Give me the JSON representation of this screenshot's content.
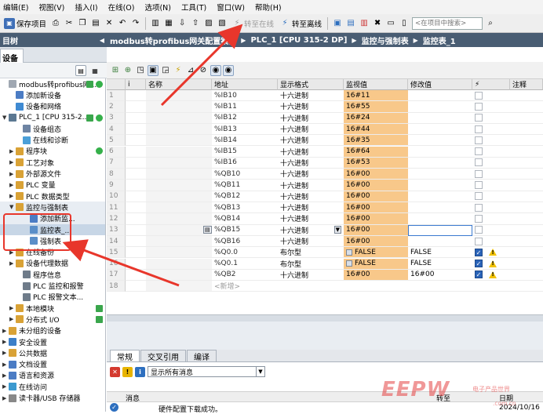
{
  "menubar": {
    "items": [
      "编辑(E)",
      "视图(V)",
      "插入(I)",
      "在线(O)",
      "选项(N)",
      "工具(T)",
      "窗口(W)",
      "帮助(H)"
    ]
  },
  "toolbar": {
    "save_label": "保存项目",
    "go_online": "转至在线",
    "go_offline": "转至离线",
    "search_placeholder": "<在项目中搜索>"
  },
  "left_panel": {
    "title": "目树",
    "tab": "设备",
    "collapse": "◀",
    "items": [
      {
        "label": "modbus转profibus网...",
        "indent": 0,
        "expander": "",
        "icon_color": "#a0a8b2",
        "status": "both"
      },
      {
        "label": "添加新设备",
        "indent": 1,
        "expander": "",
        "icon_color": "#4b7cc4",
        "status": ""
      },
      {
        "label": "设备和网络",
        "indent": 1,
        "expander": "",
        "icon_color": "#3f8ad2",
        "status": ""
      },
      {
        "label": "PLC_1 [CPU 315-2...",
        "indent": 0,
        "expander": "▼",
        "icon_color": "#5b7892",
        "status": "both"
      },
      {
        "label": "设备组态",
        "indent": 2,
        "expander": "",
        "icon_color": "#6e84a3",
        "status": ""
      },
      {
        "label": "在线和诊断",
        "indent": 2,
        "expander": "",
        "icon_color": "#4b9fd8",
        "status": ""
      },
      {
        "label": "程序块",
        "indent": 1,
        "expander": "▶",
        "icon_color": "#d9a236",
        "status": "dot"
      },
      {
        "label": "工艺对象",
        "indent": 1,
        "expander": "▶",
        "icon_color": "#d9a236",
        "status": ""
      },
      {
        "label": "外部源文件",
        "indent": 1,
        "expander": "▶",
        "icon_color": "#d9a236",
        "status": ""
      },
      {
        "label": "PLC 变量",
        "indent": 1,
        "expander": "▶",
        "icon_color": "#d9a236",
        "status": ""
      },
      {
        "label": "PLC 数据类型",
        "indent": 1,
        "expander": "▶",
        "icon_color": "#d9a236",
        "status": ""
      },
      {
        "label": "监控与强制表",
        "indent": 1,
        "expander": "▼",
        "icon_color": "#d9a236",
        "status": "",
        "sel": true
      },
      {
        "label": "添加新监...",
        "indent": 3,
        "expander": "",
        "icon_color": "#4b7cc4",
        "status": "",
        "sel": true
      },
      {
        "label": "监控表_...",
        "indent": 3,
        "expander": "",
        "icon_color": "#5a8ec8",
        "status": "",
        "hl": true
      },
      {
        "label": "强制表",
        "indent": 3,
        "expander": "",
        "icon_color": "#5a8ec8",
        "status": ""
      },
      {
        "label": "在线备份",
        "indent": 1,
        "expander": "▶",
        "icon_color": "#d9a236",
        "status": ""
      },
      {
        "label": "设备代理数据",
        "indent": 1,
        "expander": "▶",
        "icon_color": "#d9a236",
        "status": ""
      },
      {
        "label": "程序信息",
        "indent": 2,
        "expander": "",
        "icon_color": "#6f7c8a",
        "status": ""
      },
      {
        "label": "PLC 监控和报警",
        "indent": 2,
        "expander": "",
        "icon_color": "#6f7c8a",
        "status": ""
      },
      {
        "label": "PLC 报警文本...",
        "indent": 2,
        "expander": "",
        "icon_color": "#6f7c8a",
        "status": ""
      },
      {
        "label": "本地模块",
        "indent": 1,
        "expander": "▶",
        "icon_color": "#d9a236",
        "status": "chk"
      },
      {
        "label": "分布式 I/O",
        "indent": 1,
        "expander": "▶",
        "icon_color": "#d9a236",
        "status": "chk"
      },
      {
        "label": "未分组的设备",
        "indent": 0,
        "expander": "▶",
        "icon_color": "#d9a236",
        "status": ""
      },
      {
        "label": "安全设置",
        "indent": 0,
        "expander": "▶",
        "icon_color": "#3c7fc8",
        "status": ""
      },
      {
        "label": "公共数据",
        "indent": 0,
        "expander": "▶",
        "icon_color": "#d9a236",
        "status": ""
      },
      {
        "label": "文档设置",
        "indent": 0,
        "expander": "▶",
        "icon_color": "#4b7cc4",
        "status": ""
      },
      {
        "label": "语言和资源",
        "indent": 0,
        "expander": "▶",
        "icon_color": "#4b7cc4",
        "status": ""
      },
      {
        "label": "在线访问",
        "indent": 0,
        "expander": "▶",
        "icon_color": "#3c9ad0",
        "status": ""
      },
      {
        "label": "读卡器/USB 存储器",
        "indent": 0,
        "expander": "▶",
        "icon_color": "#888888",
        "status": ""
      }
    ]
  },
  "breadcrumb": [
    "modbus转profibus网关配置案例",
    "PLC_1 [CPU 315-2 DP]",
    "监控与强制表",
    "监控表_1"
  ],
  "table": {
    "headers": [
      "i",
      "名称",
      "地址",
      "显示格式",
      "监视值",
      "修改值",
      "⚡",
      "注释"
    ],
    "rows": [
      {
        "n": "1",
        "addr": "%IB10",
        "fmt": "十六进制",
        "mon": "16#11",
        "mod": "",
        "bool": false,
        "chk": "",
        "warn": false
      },
      {
        "n": "2",
        "addr": "%IB11",
        "fmt": "十六进制",
        "mon": "16#55",
        "mod": "",
        "bool": false,
        "chk": "",
        "warn": false
      },
      {
        "n": "3",
        "addr": "%IB12",
        "fmt": "十六进制",
        "mon": "16#24",
        "mod": "",
        "bool": false,
        "chk": "",
        "warn": false
      },
      {
        "n": "4",
        "addr": "%IB13",
        "fmt": "十六进制",
        "mon": "16#44",
        "mod": "",
        "bool": false,
        "chk": "",
        "warn": false
      },
      {
        "n": "5",
        "addr": "%IB14",
        "fmt": "十六进制",
        "mon": "16#35",
        "mod": "",
        "bool": false,
        "chk": "",
        "warn": false
      },
      {
        "n": "6",
        "addr": "%IB15",
        "fmt": "十六进制",
        "mon": "16#64",
        "mod": "",
        "bool": false,
        "chk": "",
        "warn": false
      },
      {
        "n": "7",
        "addr": "%IB16",
        "fmt": "十六进制",
        "mon": "16#53",
        "mod": "",
        "bool": false,
        "chk": "",
        "warn": false
      },
      {
        "n": "8",
        "addr": "%QB10",
        "fmt": "十六进制",
        "mon": "16#00",
        "mod": "",
        "bool": false,
        "chk": "",
        "warn": false
      },
      {
        "n": "9",
        "addr": "%QB11",
        "fmt": "十六进制",
        "mon": "16#00",
        "mod": "",
        "bool": false,
        "chk": "",
        "warn": false
      },
      {
        "n": "10",
        "addr": "%QB12",
        "fmt": "十六进制",
        "mon": "16#00",
        "mod": "",
        "bool": false,
        "chk": "",
        "warn": false
      },
      {
        "n": "11",
        "addr": "%QB13",
        "fmt": "十六进制",
        "mon": "16#00",
        "mod": "",
        "bool": false,
        "chk": "",
        "warn": false
      },
      {
        "n": "12",
        "addr": "%QB14",
        "fmt": "十六进制",
        "mon": "16#00",
        "mod": "",
        "bool": false,
        "chk": "",
        "warn": false
      },
      {
        "n": "13",
        "addr": "%QB15",
        "fmt": "十六进制",
        "mon": "16#00",
        "mod": "",
        "bool": false,
        "chk": "",
        "warn": false,
        "active": true
      },
      {
        "n": "14",
        "addr": "%QB16",
        "fmt": "十六进制",
        "mon": "16#00",
        "mod": "",
        "bool": false,
        "chk": "",
        "warn": false
      },
      {
        "n": "15",
        "addr": "%Q0.0",
        "fmt": "布尔型",
        "mon": "FALSE",
        "mod": "FALSE",
        "bool": true,
        "chk": "on",
        "warn": true
      },
      {
        "n": "16",
        "addr": "%Q0.1",
        "fmt": "布尔型",
        "mon": "FALSE",
        "mod": "FALSE",
        "bool": true,
        "chk": "on",
        "warn": true
      },
      {
        "n": "17",
        "addr": "%QB2",
        "fmt": "十六进制",
        "mon": "16#00",
        "mod": "16#00",
        "bool": false,
        "chk": "on",
        "warn": true
      },
      {
        "n": "18",
        "addr": "<新增>",
        "fmt": "",
        "mon": "",
        "mod": "",
        "bool": false,
        "chk": "",
        "warn": false,
        "new": true
      }
    ]
  },
  "bottom": {
    "tabs": [
      "常规",
      "交叉引用",
      "编译"
    ],
    "filter": "显示所有消息",
    "col_msg": "消息",
    "col_goto": "转至",
    "col_date": "日期",
    "msg_text": "硬件配置下载成功。",
    "msg_date": "2024/10/16"
  },
  "watermark": {
    "main": "EEPW",
    "sub": "电子产品世界",
    "url": ".com.cn"
  },
  "colors": {
    "header_blue": "#495d73",
    "monitor_orange": "#f8c88a",
    "arrow_red": "#e8362b"
  }
}
